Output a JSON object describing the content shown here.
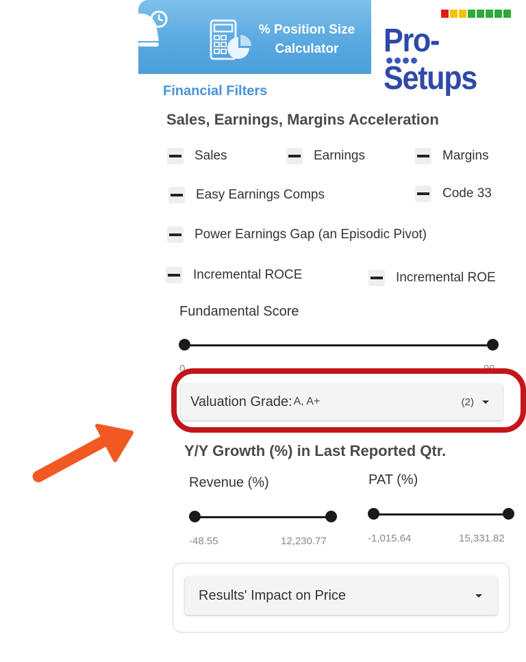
{
  "banner": {
    "calculator_title_line1": "% Position Size",
    "calculator_title_line2": "Calculator",
    "brand_name": "Pro-Setups",
    "brand_bar_colors": [
      "#e01b1b",
      "#f2c300",
      "#f2c300",
      "#2eaa3c",
      "#2eaa3c",
      "#2eaa3c",
      "#2eaa3c",
      "#2eaa3c"
    ],
    "calc_gradient": [
      "#7fc0ea",
      "#4b9fd9"
    ]
  },
  "filters": {
    "section_title": "Financial Filters",
    "acceleration_heading": "Sales, Earnings, Margins Acceleration",
    "toggles": {
      "sales": "Sales",
      "earnings": "Earnings",
      "margins": "Margins",
      "easy_earnings_comps": "Easy Earnings Comps",
      "code_33": "Code 33",
      "power_earnings_gap": "Power Earnings Gap (an Episodic Pivot)",
      "incremental_roce": "Incremental ROCE",
      "incremental_roe": "Incremental ROE"
    },
    "fundamental_score": {
      "label": "Fundamental Score",
      "min_label": "0",
      "max_label": "99",
      "range": [
        0,
        99
      ]
    },
    "valuation_grade": {
      "label": "Valuation Grade: ",
      "value": "A, A+",
      "count": "(2)"
    },
    "growth_heading": "Y/Y Growth (%) in Last Reported Qtr.",
    "revenue": {
      "label": "Revenue (%)",
      "min_label": "-48.55",
      "max_label": "12,230.77"
    },
    "pat": {
      "label": "PAT (%)",
      "min_label": "-1,015.64",
      "max_label": "15,331.82"
    },
    "results_impact": {
      "label": "Results' Impact on Price"
    }
  },
  "annotation": {
    "highlight_color": "#c2161b",
    "arrow_color": "#f05a22"
  }
}
